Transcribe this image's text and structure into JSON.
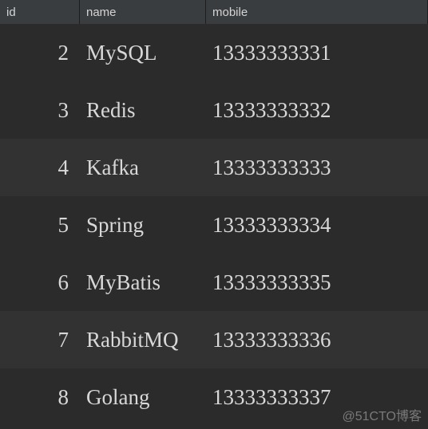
{
  "table": {
    "columns": {
      "id": "id",
      "name": "name",
      "mobile": "mobile"
    },
    "rows": [
      {
        "id": "2",
        "name": "MySQL",
        "mobile": "13333333331"
      },
      {
        "id": "3",
        "name": "Redis",
        "mobile": "13333333332"
      },
      {
        "id": "4",
        "name": "Kafka",
        "mobile": "13333333333"
      },
      {
        "id": "5",
        "name": "Spring",
        "mobile": "13333333334"
      },
      {
        "id": "6",
        "name": "MyBatis",
        "mobile": "13333333335"
      },
      {
        "id": "7",
        "name": "RabbitMQ",
        "mobile": "13333333336"
      },
      {
        "id": "8",
        "name": "Golang",
        "mobile": "13333333337"
      }
    ]
  },
  "watermark": "@51CTO博客"
}
